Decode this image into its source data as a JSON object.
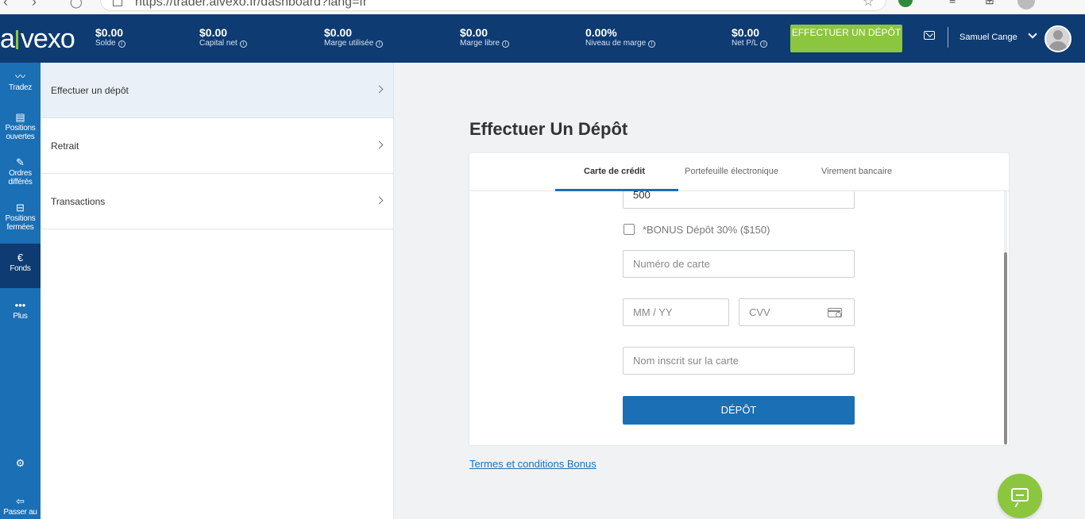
{
  "browser": {
    "url": "https://trader.alvexo.fr/dashboard?lang=fr"
  },
  "header": {
    "logo": "alvexo",
    "stats": [
      {
        "value": "$0.00",
        "label": "Solde"
      },
      {
        "value": "$0.00",
        "label": "Capital net"
      },
      {
        "value": "$0.00",
        "label": "Marge utilisée"
      },
      {
        "value": "$0.00",
        "label": "Marge libre"
      },
      {
        "value": "0.00%",
        "label": "Niveau de marge"
      },
      {
        "value": "$0.00",
        "label": "Net P/L"
      }
    ],
    "deposit_button": "EFFECTUER UN DÉPÔT",
    "username": "Samuel Cange"
  },
  "sidebar": {
    "items": [
      {
        "label": "Tradez",
        "icon": "chart-line-icon"
      },
      {
        "label": "Positions ouvertes",
        "icon": "document-icon"
      },
      {
        "label": "Ordres différés",
        "icon": "edit-icon"
      },
      {
        "label": "Positions fermées",
        "icon": "briefcase-icon"
      },
      {
        "label": "Fonds",
        "icon": "euro-icon"
      },
      {
        "label": "Plus",
        "icon": "more-icon"
      },
      {
        "label": "",
        "icon": "gear-icon"
      },
      {
        "label": "Passer au",
        "icon": "swap-icon"
      }
    ],
    "active": "Fonds"
  },
  "submenu": {
    "items": [
      {
        "label": "Effectuer un dépôt"
      },
      {
        "label": "Retrait"
      },
      {
        "label": "Transactions"
      }
    ]
  },
  "main": {
    "title": "Effectuer Un Dépôt",
    "tabs": [
      {
        "label": "Carte de crédit"
      },
      {
        "label": "Portefeuille électronique"
      },
      {
        "label": "Virement bancaire"
      }
    ],
    "form": {
      "amount_value": "500",
      "bonus_label": "*BONUS Dépôt 30% ($150)",
      "card_number_placeholder": "Numéro de carte",
      "expiry_placeholder": "MM / YY",
      "cvv_placeholder": "CVV",
      "name_placeholder": "Nom inscrit sur la carte",
      "submit": "DÉPÔT"
    },
    "terms_link": "Termes et conditions Bonus"
  },
  "colors": {
    "header_bg": "#0d3b72",
    "sidebar_bg": "#1a6fb5",
    "accent_green": "#8cc63f",
    "primary_blue": "#1a6fb5"
  }
}
